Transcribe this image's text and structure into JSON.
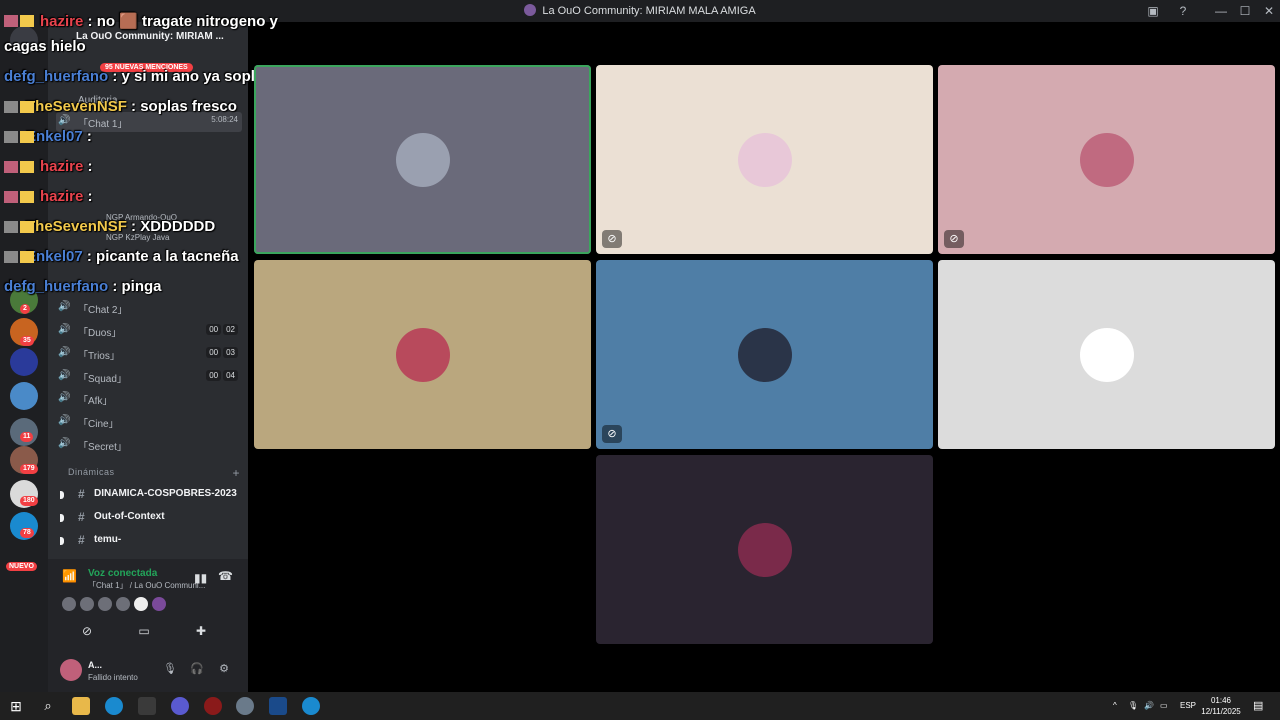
{
  "window": {
    "title": "La OuO Community: MIRIAM MALA AMIGA"
  },
  "sidebar": {
    "server_name": "La OuO Community: MIRIAM ...",
    "mentions_badge": "95 NUEVAS MENCIONES",
    "voice_channels": [
      {
        "label": "Auditoria",
        "count": []
      },
      {
        "label": "「Chat 1」",
        "count": [
          "5:08:24"
        ]
      },
      {
        "label": "「Chat 2」",
        "count": []
      },
      {
        "label": "「Duos」",
        "count": [
          "00",
          "02"
        ]
      },
      {
        "label": "「Trios」",
        "count": [
          "00",
          "03"
        ]
      },
      {
        "label": "「Squad」",
        "count": [
          "00",
          "04"
        ]
      },
      {
        "label": "「Afk」",
        "count": []
      },
      {
        "label": "「Cine」",
        "count": []
      },
      {
        "label": "「Secret」",
        "count": []
      }
    ],
    "members_in_chat": [
      "NGP Armando-OuO",
      "NGP KzPlay Java"
    ],
    "category": "Dinámicas",
    "text_channels": [
      {
        "label": "DINAMICA-COSPOBRES-2023"
      },
      {
        "label": "Out-of-Context"
      },
      {
        "label": "temu-"
      }
    ],
    "voice_panel": {
      "status": "Voz conectada",
      "sub": "「Chat 1」 / La OuO Communi..."
    },
    "user": {
      "name": "A...",
      "status": "Fallido intento"
    }
  },
  "rail": {
    "badges": [
      "2",
      "35",
      "11",
      "179",
      "180",
      "78"
    ],
    "nuevo": "NUEVO"
  },
  "chat": [
    {
      "user": "hazire",
      "user_color": "#e8434d",
      "text": ": no 🟫 tragate nitrogeno y"
    },
    {
      "user": "",
      "user_color": "#ffffff",
      "text": "cagas hielo"
    },
    {
      "user": "defg_huerfano",
      "user_color": "#4a7fd4",
      "text": ": y si mi ano ya soplaba"
    },
    {
      "user": "TheSevenNSF",
      "user_color": "#f2c94c",
      "text": ": soplas fresco"
    },
    {
      "user": "Enkel07",
      "user_color": "#4a7fd4",
      "text": ":"
    },
    {
      "user": "hazire",
      "user_color": "#e8434d",
      "text": ":"
    },
    {
      "user": "hazire",
      "user_color": "#e8434d",
      "text": ":"
    },
    {
      "user": "TheSevenNSF",
      "user_color": "#f2c94c",
      "text": ": XDDDDDD"
    },
    {
      "user": "Enkel07",
      "user_color": "#4a7fd4",
      "text": ": picante a la tacneña"
    },
    {
      "user": "defg_huerfano",
      "user_color": "#4a7fd4",
      "text": ": pinga"
    }
  ],
  "tiles": [
    {
      "bg": "#6a6a7a",
      "avatar": "#9aa0b0",
      "muted": false,
      "speaking": true
    },
    {
      "bg": "#ebe0d4",
      "avatar": "#e8c8d8",
      "muted": true,
      "speaking": false
    },
    {
      "bg": "#d4aab0",
      "avatar": "#c06a80",
      "muted": true,
      "speaking": false
    },
    {
      "bg": "#baa77e",
      "avatar": "#b84a5c",
      "muted": false,
      "speaking": false
    },
    {
      "bg": "#4f7ea6",
      "avatar": "#2a3448",
      "muted": true,
      "speaking": false
    },
    {
      "bg": "#dcdcdc",
      "avatar": "#ffffff",
      "muted": false,
      "speaking": false
    },
    {
      "bg": "#2a2430",
      "avatar": "#7a2a4a",
      "muted": false,
      "speaking": false
    }
  ],
  "taskbar": {
    "lang": "ESP",
    "time": "01:46",
    "date": "12/11/2025"
  }
}
